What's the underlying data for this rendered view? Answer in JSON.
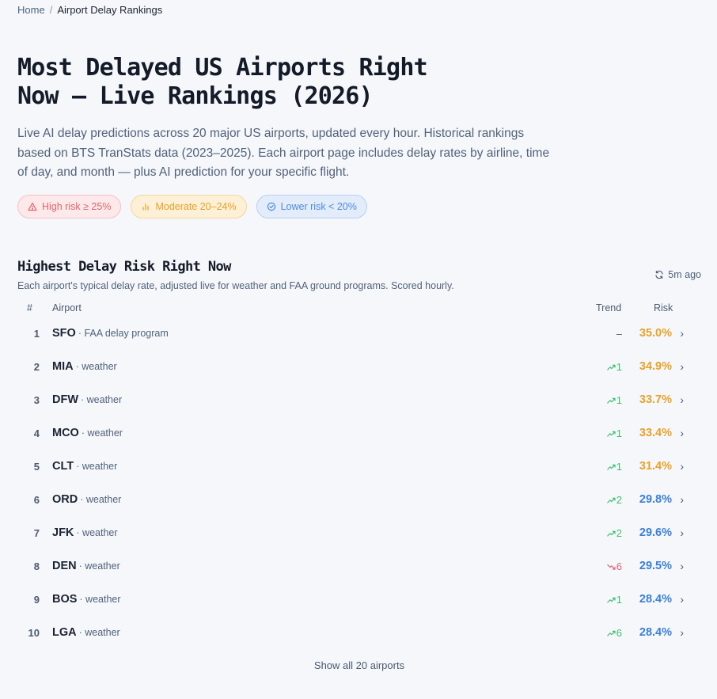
{
  "breadcrumb": {
    "home": "Home",
    "separator": "/",
    "current": "Airport Delay Rankings"
  },
  "title": "Most Delayed US Airports Right Now — Live Rankings (2026)",
  "intro": "Live AI delay predictions across 20 major US airports, updated every hour. Historical rankings based on BTS TranStats data (2023–2025). Each airport page includes delay rates by airline, time of day, and month — plus AI prediction for your specific flight.",
  "legend": {
    "high": {
      "label": "High risk ≥ 25%",
      "icon": "warning-triangle-icon",
      "color": "#e0656e"
    },
    "moderate": {
      "label": "Moderate 20–24%",
      "icon": "bar-chart-icon",
      "color": "#e7a12b"
    },
    "lower": {
      "label": "Lower risk < 20%",
      "icon": "check-circle-icon",
      "color": "#4f8ae0"
    }
  },
  "section": {
    "title": "Highest Delay Risk Right Now",
    "subtitle": "Each airport's typical delay rate, adjusted live for weather and FAA ground programs. Scored hourly.",
    "updated": "5m ago",
    "updated_icon": "refresh-icon"
  },
  "table": {
    "headers": {
      "rank": "#",
      "airport": "Airport",
      "trend": "Trend",
      "risk": "Risk"
    },
    "rows": [
      {
        "rank": "1",
        "code": "SFO",
        "reason": "· FAA delay program",
        "trend_dir": "flat",
        "trend": "–",
        "risk": "35.0%",
        "level": "moderate"
      },
      {
        "rank": "2",
        "code": "MIA",
        "reason": "· weather",
        "trend_dir": "up",
        "trend": "1",
        "risk": "34.9%",
        "level": "moderate"
      },
      {
        "rank": "3",
        "code": "DFW",
        "reason": "· weather",
        "trend_dir": "up",
        "trend": "1",
        "risk": "33.7%",
        "level": "moderate"
      },
      {
        "rank": "4",
        "code": "MCO",
        "reason": "· weather",
        "trend_dir": "up",
        "trend": "1",
        "risk": "33.4%",
        "level": "moderate"
      },
      {
        "rank": "5",
        "code": "CLT",
        "reason": "· weather",
        "trend_dir": "up",
        "trend": "1",
        "risk": "31.4%",
        "level": "moderate"
      },
      {
        "rank": "6",
        "code": "ORD",
        "reason": "· weather",
        "trend_dir": "up",
        "trend": "2",
        "risk": "29.8%",
        "level": "lower"
      },
      {
        "rank": "7",
        "code": "JFK",
        "reason": "· weather",
        "trend_dir": "up",
        "trend": "2",
        "risk": "29.6%",
        "level": "lower"
      },
      {
        "rank": "8",
        "code": "DEN",
        "reason": "· weather",
        "trend_dir": "down",
        "trend": "6",
        "risk": "29.5%",
        "level": "lower"
      },
      {
        "rank": "9",
        "code": "BOS",
        "reason": "· weather",
        "trend_dir": "up",
        "trend": "1",
        "risk": "28.4%",
        "level": "lower"
      },
      {
        "rank": "10",
        "code": "LGA",
        "reason": "· weather",
        "trend_dir": "up",
        "trend": "6",
        "risk": "28.4%",
        "level": "lower"
      }
    ],
    "chevron": "›"
  },
  "show_all": "Show all 20 airports"
}
